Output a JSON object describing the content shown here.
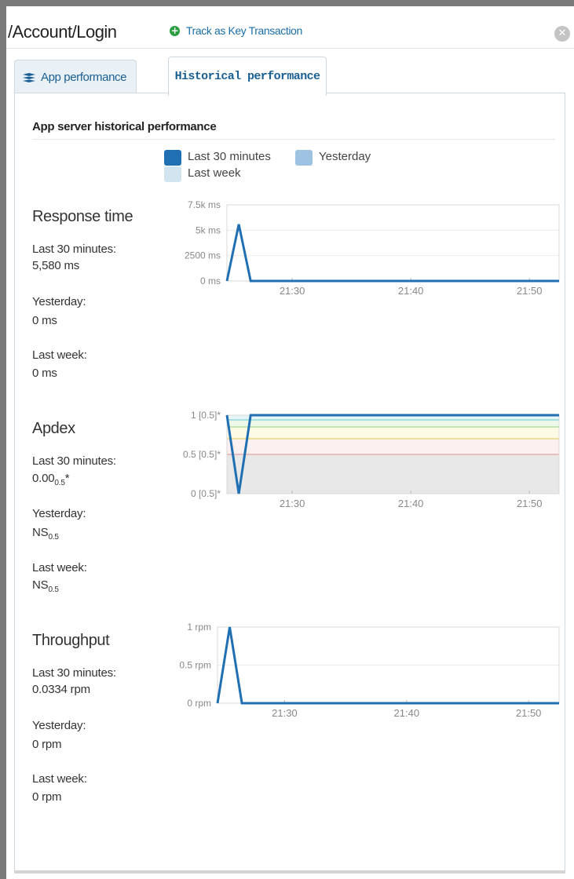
{
  "header": {
    "transaction_title": "/Account/Login",
    "key_transaction_link": "Track as Key Transaction",
    "close_icon": "close-circle-icon"
  },
  "tabs": [
    {
      "label": "App performance",
      "icon": "layers-icon",
      "active": false
    },
    {
      "label": "Historical performance",
      "active": true
    }
  ],
  "section": {
    "title": "App server historical performance"
  },
  "legend": [
    {
      "label": "Last 30 minutes",
      "color": "#1f6fb2"
    },
    {
      "label": "Yesterday",
      "color": "#9ec3e2"
    },
    {
      "label": "Last week",
      "color": "#d3e4f1"
    }
  ],
  "metrics": {
    "response_time": {
      "title": "Response time",
      "stats": [
        {
          "label": "Last 30 minutes:",
          "value": "5,580 ms"
        },
        {
          "label": "Yesterday:",
          "value": "0 ms"
        },
        {
          "label": "Last week:",
          "value": "0 ms"
        }
      ]
    },
    "apdex": {
      "title": "Apdex",
      "stats": [
        {
          "label": "Last 30 minutes:",
          "value": "0.00",
          "sub": "0.5",
          "suffix": "*"
        },
        {
          "label": "Yesterday:",
          "value": "NS",
          "sub": "0.5",
          "suffix": ""
        },
        {
          "label": "Last week:",
          "value": "NS",
          "sub": "0.5",
          "suffix": ""
        }
      ]
    },
    "throughput": {
      "title": "Throughput",
      "stats": [
        {
          "label": "Last 30 minutes:",
          "value": "0.0334 rpm"
        },
        {
          "label": "Yesterday:",
          "value": "0 rpm"
        },
        {
          "label": "Last week:",
          "value": "0 rpm"
        }
      ]
    }
  },
  "chart_data": [
    {
      "id": "response_time",
      "type": "line",
      "y_tick_labels": [
        "0 ms",
        "2500 ms",
        "5k ms",
        "7.5k ms"
      ],
      "y_ticks": [
        0,
        2500,
        5000,
        7500
      ],
      "ylim": [
        0,
        7500
      ],
      "x_tick_labels": [
        "21:30",
        "21:40",
        "21:50"
      ],
      "x_ticks": [
        1290,
        1300,
        1310
      ],
      "xlim": [
        1284.5,
        1312.5
      ],
      "series": [
        {
          "name": "Last 30 minutes",
          "color": "#1f6fb2",
          "x": [
            1284.5,
            1285.5,
            1286.5,
            1312.5
          ],
          "y": [
            0,
            5580,
            0,
            0
          ]
        }
      ],
      "grid": true
    },
    {
      "id": "apdex",
      "type": "line",
      "y_tick_labels": [
        "0 [0.5]*",
        "0.5 [0.5]*",
        "1 [0.5]*"
      ],
      "y_ticks": [
        0,
        0.5,
        1
      ],
      "ylim": [
        0,
        1
      ],
      "x_tick_labels": [
        "21:30",
        "21:40",
        "21:50"
      ],
      "x_ticks": [
        1290,
        1300,
        1310
      ],
      "xlim": [
        1284.5,
        1312.5
      ],
      "bands": [
        {
          "from": 0,
          "to": 0.5,
          "color": "#e8e8e8"
        },
        {
          "from": 0.5,
          "to": 0.7,
          "color": "#fdf0f0"
        },
        {
          "from": 0.7,
          "to": 0.85,
          "color": "#fdfbe6"
        },
        {
          "from": 0.85,
          "to": 0.94,
          "color": "#eef8ea"
        },
        {
          "from": 0.94,
          "to": 1,
          "color": "#e6f6f6"
        }
      ],
      "thresholds": [
        {
          "value": 0.5,
          "color": "#e3a3a3"
        },
        {
          "value": 0.7,
          "color": "#e6d36b"
        },
        {
          "value": 0.85,
          "color": "#a9d98f"
        },
        {
          "value": 0.94,
          "color": "#7fd3d3"
        }
      ],
      "series": [
        {
          "name": "Last 30 minutes",
          "color": "#1f6fb2",
          "x": [
            1284.5,
            1285.5,
            1286.5,
            1312.5
          ],
          "y": [
            1,
            0,
            1,
            1
          ]
        }
      ],
      "grid": true
    },
    {
      "id": "throughput",
      "type": "line",
      "y_tick_labels": [
        "0 rpm",
        "0.5 rpm",
        "1 rpm"
      ],
      "y_ticks": [
        0,
        0.5,
        1
      ],
      "ylim": [
        0,
        1
      ],
      "x_tick_labels": [
        "21:30",
        "21:40",
        "21:50"
      ],
      "x_ticks": [
        1290,
        1300,
        1310
      ],
      "xlim": [
        1284.5,
        1312.5
      ],
      "series": [
        {
          "name": "Last 30 minutes",
          "color": "#1f6fb2",
          "x": [
            1284.5,
            1285.5,
            1286.5,
            1312.5
          ],
          "y": [
            0,
            1,
            0,
            0
          ]
        }
      ],
      "grid": true
    }
  ]
}
